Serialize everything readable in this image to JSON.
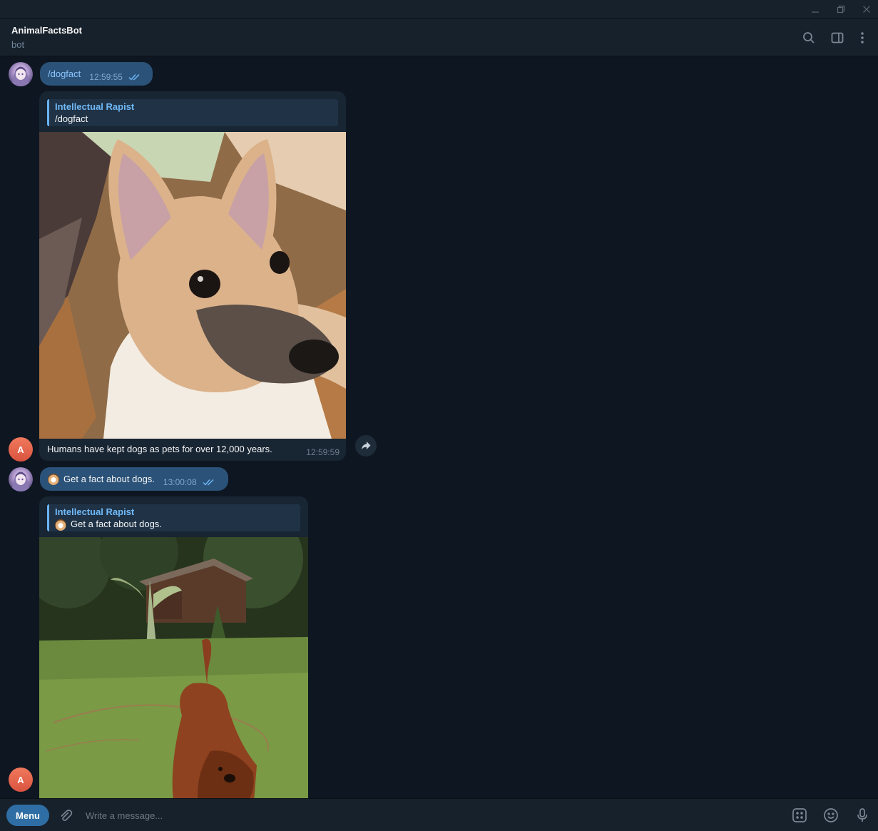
{
  "window": {
    "minimize_icon": "minimize-icon",
    "maximize_icon": "restore-icon",
    "close_icon": "close-icon"
  },
  "header": {
    "title": "AnimalFactsBot",
    "status": "bot",
    "icons": [
      "search-icon",
      "sidebar-toggle-icon",
      "more-vert-icon"
    ]
  },
  "messages": [
    {
      "direction": "out",
      "text": "/dogfact",
      "time": "12:59:55",
      "read": true
    },
    {
      "direction": "in",
      "avatar_letter": "A",
      "reply_to_name": "Intellectual Rapist",
      "reply_to_text": "/dogfact",
      "photo": "puppy-photo",
      "caption": "Humans have kept dogs as pets for over 12,000 years.",
      "time": "12:59:59"
    },
    {
      "direction": "out",
      "text": "Get a fact about dogs.",
      "time": "13:00:08",
      "read": true
    },
    {
      "direction": "in",
      "avatar_letter": "A",
      "reply_to_name": "Intellectual Rapist",
      "reply_to_text": "Get a fact about dogs.",
      "photo": "setter-dog-photo"
    }
  ],
  "input": {
    "menu_label": "Menu",
    "placeholder": "Write a message...",
    "icons": [
      "attach-icon",
      "bot-commands-icon",
      "emoji-icon",
      "microphone-icon"
    ]
  },
  "colors": {
    "background": "#0e1621",
    "header": "#17212b",
    "outgoing_bubble": "#2b5278",
    "incoming_bubble": "#182533",
    "accent": "#6ab3f3",
    "menu_button": "#2f6ea5",
    "bot_avatar": "#e5654a"
  }
}
